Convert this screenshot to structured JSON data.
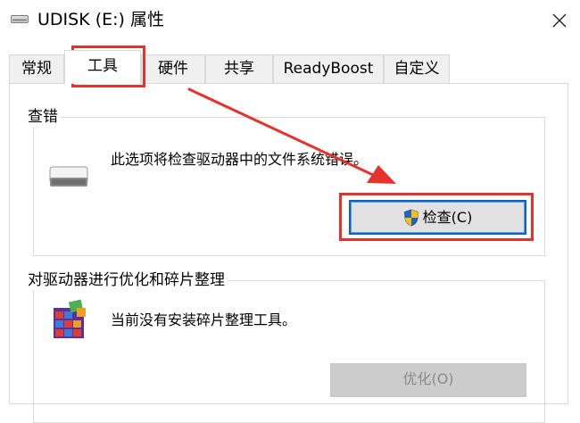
{
  "window": {
    "title": "UDISK (E:) 属性",
    "icon": "drive-icon",
    "close_icon": "close-icon"
  },
  "tabs": [
    {
      "label": "常规",
      "active": false
    },
    {
      "label": "工具",
      "active": true
    },
    {
      "label": "硬件",
      "active": false
    },
    {
      "label": "共享",
      "active": false
    },
    {
      "label": "ReadyBoost",
      "active": false
    },
    {
      "label": "自定义",
      "active": false
    }
  ],
  "error_check": {
    "legend": "查错",
    "description": "此选项将检查驱动器中的文件系统错误。",
    "button_label": "检查(C)",
    "button_icon": "shield-icon",
    "icon": "drive-icon"
  },
  "optimize": {
    "legend": "对驱动器进行优化和碎片整理",
    "description": "当前没有安装碎片整理工具。",
    "button_label": "优化(O)",
    "button_enabled": false,
    "icon": "defrag-icon"
  },
  "colors": {
    "annotation_red": "#e5322d",
    "focus_blue": "#0a64c8",
    "tab_inactive_bg": "#f0f0f0",
    "disabled_button_bg": "#cccccc"
  }
}
